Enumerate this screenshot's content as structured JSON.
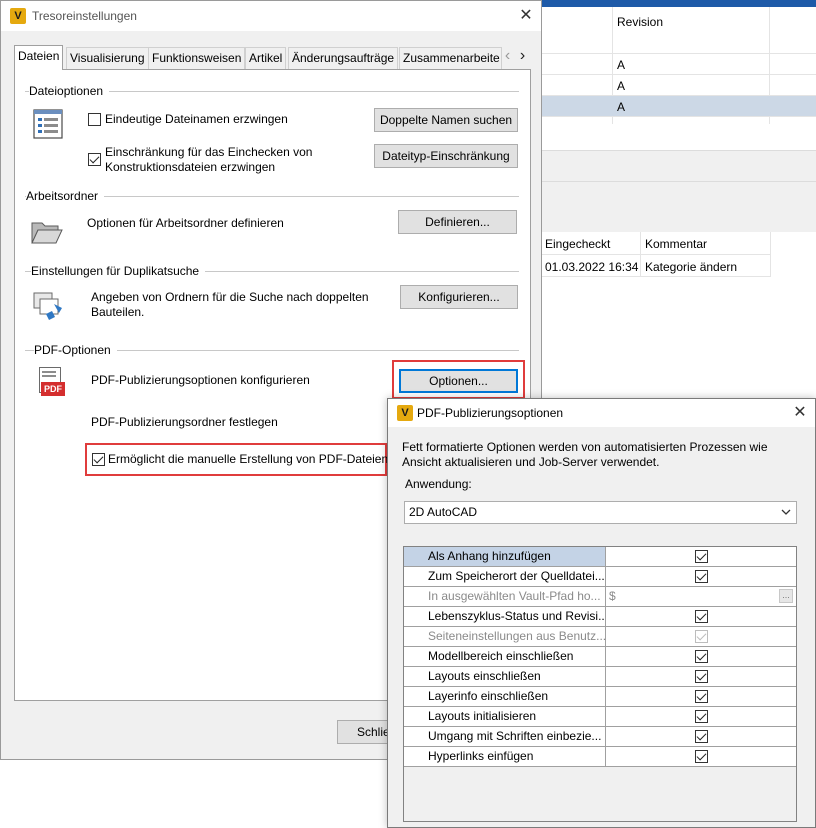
{
  "background_app": {
    "grid_header_revision": "Revision",
    "rows": [
      "A",
      "A",
      "A"
    ],
    "history_headers": [
      "Eingecheckt",
      "Kommentar"
    ],
    "history_row": [
      "01.03.2022 16:34",
      "Kategorie ändern"
    ]
  },
  "main_dialog": {
    "logo": "V",
    "title": "Tresoreinstellungen",
    "close_glyph": "✕",
    "tabs": [
      "Dateien",
      "Visualisierung",
      "Funktionsweisen",
      "Artikel",
      "Änderungsaufträge",
      "Zusammenarbeite"
    ],
    "tab_prev": "‹",
    "tab_next": "›",
    "file_options": {
      "title": "Dateioptionen",
      "unique_names_label": "Eindeutige Dateinamen erzwingen",
      "unique_names_checked": false,
      "duplicates_button": "Doppelte Namen suchen",
      "restriction_label_1": "Einschränkung für das Einchecken von",
      "restriction_label_2": "Konstruktionsdateien erzwingen",
      "restriction_checked": true,
      "filetype_button": "Dateityp-Einschränkung"
    },
    "working_folder": {
      "title": "Arbeitsordner",
      "label": "Optionen für Arbeitsordner definieren",
      "button": "Definieren..."
    },
    "duplicate_search": {
      "title": "Einstellungen für Duplikatsuche",
      "label_1": "Angeben von Ordnern für die Suche nach doppelten",
      "label_2": "Bauteilen.",
      "button": "Konfigurieren..."
    },
    "pdf_options": {
      "title": "PDF-Optionen",
      "pdf_icon_text": "PDF",
      "configure_label": "PDF-Publizierungsoptionen konfigurieren",
      "options_button": "Optionen...",
      "folder_label": "PDF-Publizierungsordner festlegen",
      "manual_label": "Ermöglicht die manuelle Erstellung von PDF-Dateien",
      "manual_checked": true
    },
    "close_button": "Schlie"
  },
  "pdf_dialog": {
    "logo": "V",
    "title": "PDF-Publizierungsoptionen",
    "close_glyph": "✕",
    "description_1": "Fett formatierte Optionen werden von automatisierten Prozessen wie",
    "description_2": "Ansicht aktualisieren und Job-Server verwendet.",
    "application_label": "Anwendung:",
    "application_value": "2D AutoCAD",
    "properties": [
      {
        "name": "Als Anhang hinzufügen",
        "checked": true,
        "selected": true,
        "disabled": false
      },
      {
        "name": "Zum Speicherort der Quelldatei...",
        "checked": true,
        "selected": false,
        "disabled": false
      },
      {
        "name": "In ausgewählten Vault-Pfad ho...",
        "text_value": "$",
        "ellipsis": "...",
        "selected": false,
        "disabled": true
      },
      {
        "name": "Lebenszyklus-Status und Revisi...",
        "checked": true,
        "selected": false,
        "disabled": false
      },
      {
        "name": "Seiteneinstellungen aus Benutz...",
        "checked": true,
        "selected": false,
        "disabled": true
      },
      {
        "name": "Modellbereich einschließen",
        "checked": true,
        "selected": false,
        "disabled": false
      },
      {
        "name": "Layouts einschließen",
        "checked": true,
        "selected": false,
        "disabled": false
      },
      {
        "name": "Layerinfo einschließen",
        "checked": true,
        "selected": false,
        "disabled": false
      },
      {
        "name": "Layouts initialisieren",
        "checked": true,
        "selected": false,
        "disabled": false
      },
      {
        "name": "Umgang mit Schriften einbezie...",
        "checked": true,
        "selected": false,
        "disabled": false
      },
      {
        "name": "Hyperlinks einfügen",
        "checked": true,
        "selected": false,
        "disabled": false
      }
    ]
  }
}
